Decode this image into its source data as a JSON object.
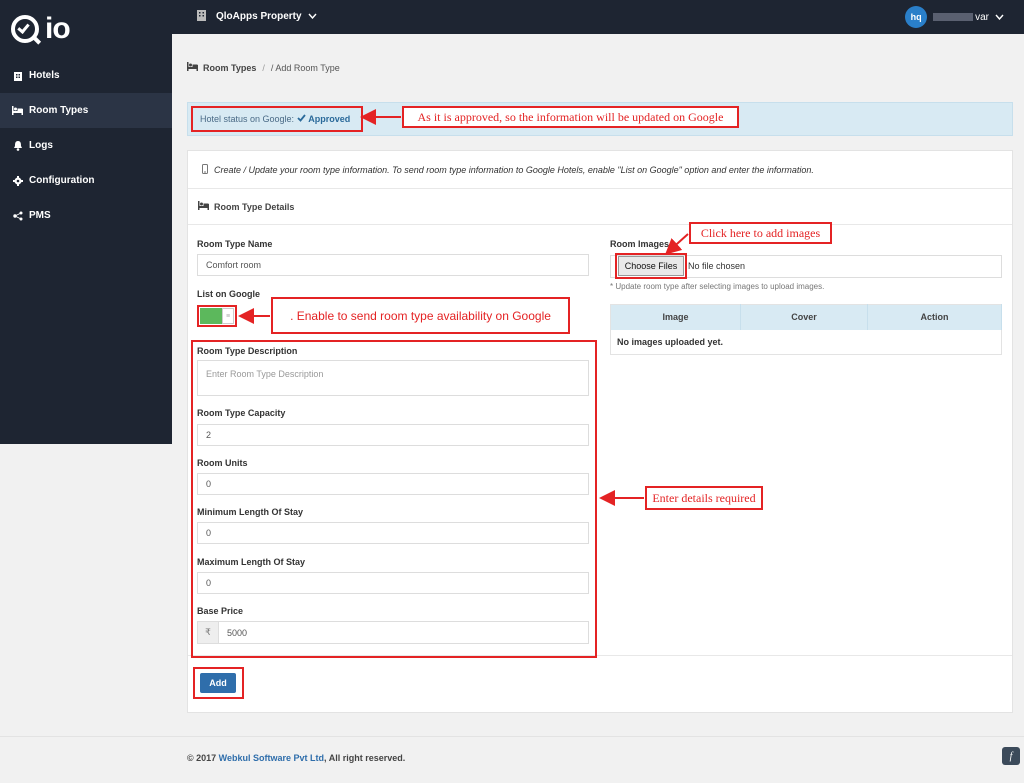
{
  "app": {
    "logo_text": "io"
  },
  "sidebar": {
    "items": [
      {
        "label": "Hotels",
        "icon": "building-icon"
      },
      {
        "label": "Room Types",
        "icon": "bed-icon"
      },
      {
        "label": "Logs",
        "icon": "bell-icon"
      },
      {
        "label": "Configuration",
        "icon": "gear-icon"
      },
      {
        "label": "PMS",
        "icon": "share-icon"
      }
    ],
    "active": "Room Types"
  },
  "topbar": {
    "property": "QloApps Property",
    "user_initials": "hq",
    "user_name_suffix": "var"
  },
  "breadcrumb": {
    "parent": "Room Types",
    "current": "/ Add Room Type"
  },
  "status": {
    "label": "Hotel status on Google:",
    "value": "Approved"
  },
  "card": {
    "info": "Create / Update your room type information. To send room type information to Google Hotels, enable \"List on Google\" option and enter the information.",
    "heading": "Room Type Details"
  },
  "form": {
    "room_type_name": {
      "label": "Room Type Name",
      "value": "Comfort room"
    },
    "list_on_google": {
      "label": "List on Google",
      "enabled": true
    },
    "description": {
      "label": "Room Type Description",
      "placeholder": "Enter Room Type Description"
    },
    "capacity": {
      "label": "Room Type Capacity",
      "value": "2"
    },
    "units": {
      "label": "Room Units",
      "value": "0"
    },
    "min_stay": {
      "label": "Minimum Length Of Stay",
      "value": "0"
    },
    "max_stay": {
      "label": "Maximum Length Of Stay",
      "value": "0"
    },
    "base_price": {
      "label": "Base Price",
      "currency": "₹",
      "value": "5000"
    },
    "add_button": "Add"
  },
  "images": {
    "label": "Room Images",
    "choose_button": "Choose Files",
    "no_file": "No file chosen",
    "hint": "* Update room type after selecting images to upload images.",
    "columns": [
      "Image",
      "Cover",
      "Action"
    ],
    "empty": "No images uploaded yet."
  },
  "annotations": {
    "approved_note": "As it is approved, so the information will be updated on Google",
    "images_note": "Click here to add images",
    "google_note": ". Enable to send room  type availability on Google",
    "details_note": "Enter details required",
    "color": "#e42324"
  },
  "footer": {
    "copyright": "© 2017",
    "company": "Webkul Software Pvt Ltd",
    "rights": ", All right reserved.",
    "badge": "f"
  }
}
